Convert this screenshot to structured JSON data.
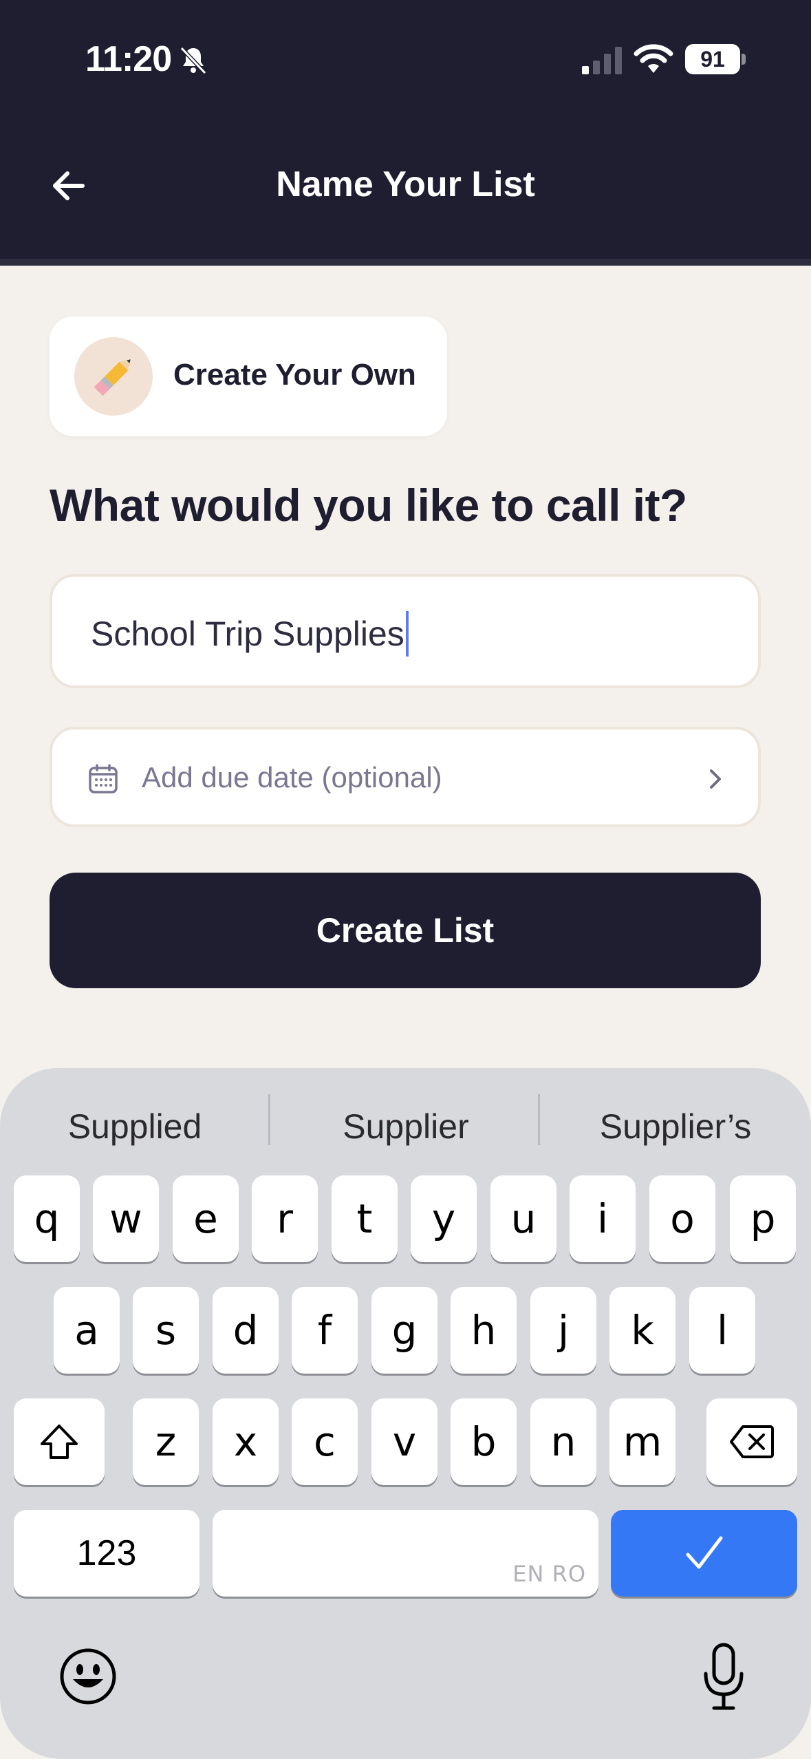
{
  "status_bar": {
    "time": "11:20",
    "battery": "91",
    "icons": [
      "bell-slash-icon",
      "cellular-signal-icon",
      "wifi-icon",
      "battery-icon"
    ]
  },
  "header": {
    "title": "Name Your List",
    "back_icon": "arrow-left-icon"
  },
  "template_chip": {
    "emoji": "✏️",
    "label": "Create Your Own"
  },
  "form": {
    "question": "What would you like to call it?",
    "name_value": "School Trip Supplies",
    "due_date_placeholder": "Add due date (optional)",
    "due_date_icon": "calendar-icon",
    "submit_label": "Create List"
  },
  "keyboard": {
    "suggestions": [
      "Supplied",
      "Supplier",
      "Supplier’s"
    ],
    "row1": [
      "q",
      "w",
      "e",
      "r",
      "t",
      "y",
      "u",
      "i",
      "o",
      "p"
    ],
    "row2": [
      "a",
      "s",
      "d",
      "f",
      "g",
      "h",
      "j",
      "k",
      "l"
    ],
    "row3": [
      "z",
      "x",
      "c",
      "v",
      "b",
      "n",
      "m"
    ],
    "numbers_label": "123",
    "space_hint": "EN RO",
    "done_icon": "checkmark-icon",
    "emoji_icon": "emoji-icon",
    "mic_icon": "microphone-icon"
  },
  "colors": {
    "header_bg": "#1F1E30",
    "page_bg": "#F4F1EC",
    "primary_button": "#1F1E30",
    "keyboard_done": "#3478F6",
    "caret": "#5B7CF6"
  }
}
